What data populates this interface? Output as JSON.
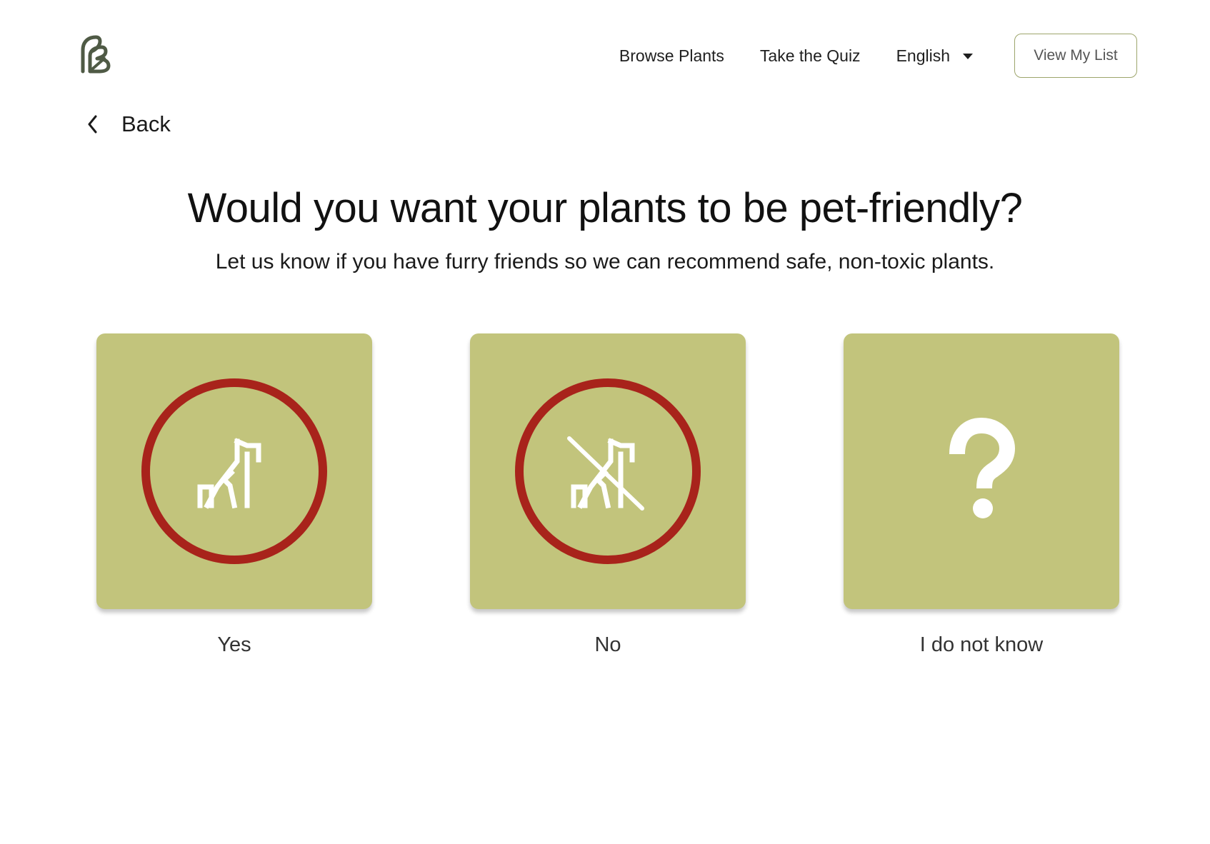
{
  "header": {
    "logo_icon": "leaf-logo-icon",
    "nav": {
      "browse_label": "Browse Plants",
      "quiz_label": "Take the Quiz",
      "language_label": "English",
      "view_list_label": "View My List"
    }
  },
  "back": {
    "label": "Back",
    "icon": "chevron-left-icon"
  },
  "question": {
    "title": "Would you want your plants to be pet-friendly?",
    "subtitle": "Let us know if you have furry friends so we can recommend safe, non-toxic plants."
  },
  "options": [
    {
      "label": "Yes",
      "icon": "pet-icon"
    },
    {
      "label": "No",
      "icon": "no-pet-icon"
    },
    {
      "label": "I do not know",
      "icon": "question-mark-icon"
    }
  ],
  "colors": {
    "card_background": "#c2c47c",
    "ring": "#a8231b",
    "icon": "#ffffff",
    "button_border": "#9da56c",
    "logo": "#4f5a45"
  }
}
